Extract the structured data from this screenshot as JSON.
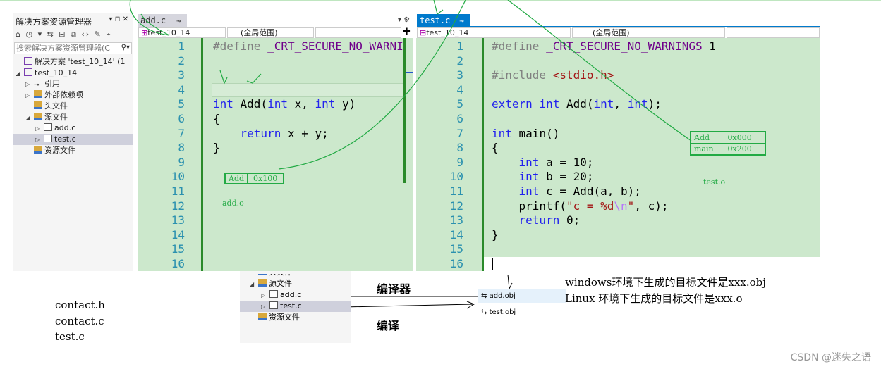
{
  "solution_explorer": {
    "title": "解决方案资源管理器",
    "title_controls": "▾ ⊓ ✕",
    "toolbar": "⌂ ◷ ▾ ⇆ ⊟ ⧉ ‹› ✎ ⌁",
    "search_placeholder": "搜索解决方案资源管理器(C",
    "items": [
      {
        "label": "解决方案 'test_10_14' (1",
        "indent": 0,
        "twisty": "",
        "icon": "solution"
      },
      {
        "label": "test_10_14",
        "indent": 0,
        "twisty": "◢",
        "icon": "project"
      },
      {
        "label": "引用",
        "indent": 1,
        "twisty": "▷",
        "icon": "references"
      },
      {
        "label": "外部依赖项",
        "indent": 1,
        "twisty": "▷",
        "icon": "external-deps"
      },
      {
        "label": "头文件",
        "indent": 1,
        "twisty": "",
        "icon": "folder"
      },
      {
        "label": "源文件",
        "indent": 1,
        "twisty": "◢",
        "icon": "folder"
      },
      {
        "label": "add.c",
        "indent": 2,
        "twisty": "▷",
        "icon": "file"
      },
      {
        "label": "test.c",
        "indent": 2,
        "twisty": "▷",
        "icon": "file",
        "selected": true
      },
      {
        "label": "资源文件",
        "indent": 1,
        "twisty": "",
        "icon": "folder"
      }
    ]
  },
  "left_editor": {
    "tab": "add.c",
    "pin": "⊸",
    "close": "✕",
    "project_dd": "test_10_14",
    "scope_dd": "(全局范围)",
    "member_dd": "",
    "line_numbers": [
      "1",
      "2",
      "3",
      "4",
      "5",
      "6",
      "7",
      "8",
      "9",
      "10",
      "11",
      "12",
      "13",
      "14",
      "15",
      "16"
    ],
    "lines": [
      [
        [
          "#define ",
          "pp"
        ],
        [
          "_CRT_SECURE_NO_WARNI",
          "mac"
        ]
      ],
      [],
      [],
      [],
      [
        [
          "int",
          "kw"
        ],
        [
          " Add(",
          ""
        ],
        [
          "int",
          "kw"
        ],
        [
          " x, ",
          ""
        ],
        [
          "int",
          "kw"
        ],
        [
          " y)",
          ""
        ]
      ],
      [
        [
          "{",
          ""
        ]
      ],
      [
        [
          "    ",
          ""
        ],
        [
          "return",
          "kw"
        ],
        [
          " x + y;",
          ""
        ]
      ],
      [
        [
          "}",
          ""
        ]
      ],
      [],
      [],
      [],
      [],
      [],
      [],
      [],
      []
    ],
    "annotation": {
      "table": [
        [
          "Add",
          "0x100"
        ]
      ],
      "label": "add.o"
    }
  },
  "right_editor": {
    "tab": "test.c",
    "pin": "⊸",
    "close": "✕",
    "project_dd": "test_10_14",
    "scope_dd": "(全局范围)",
    "member_dd": "",
    "line_numbers": [
      "1",
      "2",
      "3",
      "4",
      "5",
      "6",
      "7",
      "8",
      "9",
      "10",
      "11",
      "12",
      "13",
      "14",
      "15",
      "16"
    ],
    "lines": [
      [
        [
          "#define ",
          "pp"
        ],
        [
          "_CRT_SECURE_NO_WARNINGS",
          "mac"
        ],
        [
          " 1",
          ""
        ]
      ],
      [],
      [
        [
          "#include ",
          "pp"
        ],
        [
          "<stdio.h>",
          "str"
        ]
      ],
      [],
      [
        [
          "extern",
          "kw"
        ],
        [
          " ",
          ""
        ],
        [
          "int",
          "kw"
        ],
        [
          " Add(",
          ""
        ],
        [
          "int",
          "kw"
        ],
        [
          ", ",
          ""
        ],
        [
          "int",
          "kw"
        ],
        [
          ");",
          ""
        ]
      ],
      [],
      [
        [
          "int",
          "kw"
        ],
        [
          " main()",
          ""
        ]
      ],
      [
        [
          "{",
          ""
        ]
      ],
      [
        [
          "    ",
          ""
        ],
        [
          "int",
          "kw"
        ],
        [
          " a = 10;",
          ""
        ]
      ],
      [
        [
          "    ",
          ""
        ],
        [
          "int",
          "kw"
        ],
        [
          " b = 20;",
          ""
        ]
      ],
      [
        [
          "    ",
          ""
        ],
        [
          "int",
          "kw"
        ],
        [
          " c = Add(a, b);",
          ""
        ]
      ],
      [
        [
          "    printf(",
          ""
        ],
        [
          "\"c = %d",
          "str"
        ],
        [
          "\\n",
          "esc"
        ],
        [
          "\"",
          "str"
        ],
        [
          ", c);",
          ""
        ]
      ],
      [
        [
          "    ",
          ""
        ],
        [
          "return",
          "kw"
        ],
        [
          " 0;",
          ""
        ]
      ],
      [
        [
          "}",
          ""
        ]
      ],
      [],
      []
    ],
    "annotation": {
      "table": [
        [
          "Add",
          "0x000"
        ],
        [
          "main",
          "0x200"
        ]
      ],
      "label": "test.o"
    }
  },
  "notes": {
    "files": [
      "contact.h",
      "contact.c",
      "test.c"
    ],
    "compiler": "编译器",
    "compile": "编译",
    "windows": "windows环境下生成的目标文件是xxx.obj",
    "linux": "Linux 环境下生成的目标文件是xxx.o"
  },
  "mini_explorer": {
    "items": [
      {
        "label": "头文件",
        "partial": true
      },
      {
        "label": "源文件",
        "twisty": "◢"
      },
      {
        "label": "add.c",
        "twisty": "▷"
      },
      {
        "label": "test.c",
        "twisty": "▷",
        "selected": true
      },
      {
        "label": "资源文件",
        "twisty": ""
      }
    ]
  },
  "outputs": [
    "add.obj",
    "test.obj"
  ],
  "watermark": "CSDN @迷失之语",
  "colors": {
    "editor_bg": "#cce8cc",
    "tab_active": "#007acc",
    "annotation": "#22aa44"
  }
}
